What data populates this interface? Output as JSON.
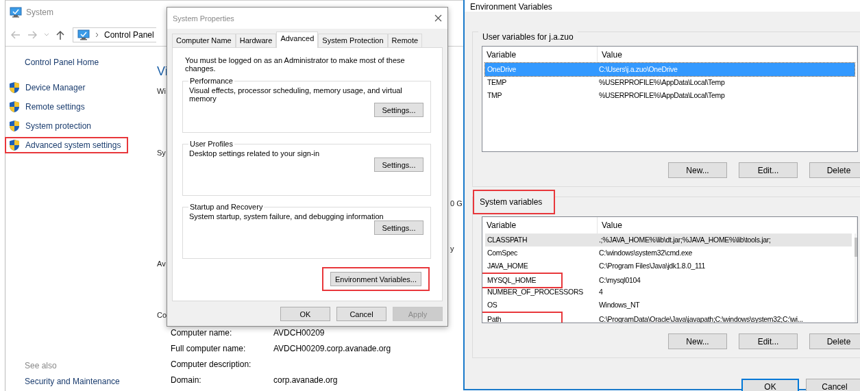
{
  "system_window": {
    "title": "System",
    "breadcrumb": [
      "Control Panel"
    ],
    "sidebar": {
      "home": "Control Panel Home",
      "items": [
        {
          "label": "Device Manager",
          "highlighted": false
        },
        {
          "label": "Remote settings",
          "highlighted": false
        },
        {
          "label": "System protection",
          "highlighted": false
        },
        {
          "label": "Advanced system settings",
          "highlighted": true
        }
      ],
      "see_also": "See also",
      "see_also_links": [
        "Security and Maintenance"
      ]
    },
    "main": {
      "fragments": [
        {
          "text": "Vi",
          "kind": "heading"
        },
        {
          "text": "Wi",
          "kind": "text"
        },
        {
          "text": "Sy",
          "kind": "text"
        },
        {
          "text": "Av",
          "kind": "text"
        },
        {
          "text": "Co",
          "kind": "text"
        }
      ],
      "right_fragments": [
        "0 G",
        "y"
      ],
      "details": [
        {
          "label": "Computer name:",
          "value": "AVDCH00209"
        },
        {
          "label": "Full computer name:",
          "value": "AVDCH00209.corp.avanade.org"
        },
        {
          "label": "Computer description:"
        },
        {
          "label": "Domain:",
          "value": "corp.avanade.org"
        }
      ]
    }
  },
  "system_properties": {
    "title": "System Properties",
    "tabs": [
      {
        "label": "Computer Name",
        "selected": false
      },
      {
        "label": "Hardware",
        "selected": false
      },
      {
        "label": "Advanced",
        "selected": true
      },
      {
        "label": "System Protection",
        "selected": false
      },
      {
        "label": "Remote",
        "selected": false
      }
    ],
    "notice": "You must be logged on as an Administrator to make most of these changes.",
    "groups": [
      {
        "title": "Performance",
        "description": "Visual effects, processor scheduling, memory usage, and virtual memory",
        "button": "Settings..."
      },
      {
        "title": "User Profiles",
        "description": "Desktop settings related to your sign-in",
        "button": "Settings..."
      },
      {
        "title": "Startup and Recovery",
        "description": "System startup, system failure, and debugging information",
        "button": "Settings..."
      }
    ],
    "env_button": {
      "label": "Environment Variables...",
      "highlighted": true
    },
    "buttons": [
      {
        "label": "OK",
        "disabled": false
      },
      {
        "label": "Cancel",
        "disabled": false
      },
      {
        "label": "Apply",
        "disabled": true
      }
    ]
  },
  "environment_variables": {
    "title": "Environment Variables",
    "user_group": {
      "title": "User variables for j.a.zuo",
      "highlighted": false,
      "columns": [
        "Variable",
        "Value"
      ],
      "rows": [
        {
          "variable": "OneDrive",
          "value": "C:\\Users\\j.a.zuo\\OneDrive",
          "selected": true,
          "hovered": false,
          "highlighted": false
        },
        {
          "variable": "TEMP",
          "value": "%USERPROFILE%\\AppData\\Local\\Temp",
          "selected": false,
          "hovered": false,
          "highlighted": false
        },
        {
          "variable": "TMP",
          "value": "%USERPROFILE%\\AppData\\Local\\Temp",
          "selected": false,
          "hovered": false,
          "highlighted": false
        }
      ],
      "buttons": [
        "New...",
        "Edit...",
        "Delete"
      ]
    },
    "system_group": {
      "title": "System variables",
      "highlighted": true,
      "columns": [
        "Variable",
        "Value"
      ],
      "rows": [
        {
          "variable": "CLASSPATH",
          "value": ".;%JAVA_HOME%\\lib\\dt.jar;%JAVA_HOME%\\lib\\tools.jar;",
          "selected": false,
          "hovered": true,
          "highlighted": false
        },
        {
          "variable": "ComSpec",
          "value": "C:\\windows\\system32\\cmd.exe",
          "selected": false,
          "hovered": false,
          "highlighted": false
        },
        {
          "variable": "JAVA_HOME",
          "value": "C:\\Program Files\\Java\\jdk1.8.0_111",
          "selected": false,
          "hovered": false,
          "highlighted": false
        },
        {
          "variable": "MYSQL_HOME",
          "value": "C:\\mysql0104",
          "selected": false,
          "hovered": false,
          "highlighted": true
        },
        {
          "variable": "NUMBER_OF_PROCESSORS",
          "value": "4",
          "selected": false,
          "hovered": false,
          "highlighted": false
        },
        {
          "variable": "OS",
          "value": "Windows_NT",
          "selected": false,
          "hovered": false,
          "highlighted": false
        },
        {
          "variable": "Path",
          "value": "C:\\ProgramData\\Oracle\\Java\\javapath;C:\\windows\\system32;C:\\wi...",
          "selected": false,
          "hovered": false,
          "highlighted": true
        }
      ],
      "buttons": [
        "New...",
        "Edit...",
        "Delete"
      ]
    },
    "buttons": [
      {
        "label": "OK",
        "default": true
      },
      {
        "label": "Cancel",
        "default": false
      }
    ]
  }
}
